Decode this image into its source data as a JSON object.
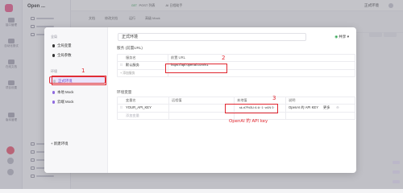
{
  "background": {
    "project_title": "Open ...",
    "rail_items": [
      "接口管理",
      "自动化测试",
      "在线文档",
      "项目设置",
      "版本管理"
    ],
    "tabs": [
      {
        "method": "GET",
        "name": "POST 列表",
        "method_color": "#2ea44f"
      },
      {
        "method": "",
        "name": "AI 日程助手",
        "method_color": "#e0733a"
      }
    ],
    "toolbar_tabs": [
      "文档",
      "修改文档",
      "运行",
      "高级 Mock"
    ],
    "top_env": "正式环境"
  },
  "modal": {
    "left": {
      "global_section": "全局",
      "global_items": [
        {
          "label": "全局变量"
        },
        {
          "label": "全局参数"
        }
      ],
      "env_section": "环境",
      "env_items": [
        {
          "label": "正式环境",
          "active": true,
          "dot": "f"
        },
        {
          "label": "本地 Mock",
          "active": false,
          "dot": "p"
        },
        {
          "label": "云端 Mock",
          "active": false,
          "dot": "p"
        }
      ],
      "add_env": "+ 新建环境"
    },
    "env_name": "正式环境",
    "share_label": "共享",
    "service_section": "服务 (前置URL)",
    "service_table": {
      "headers": [
        "服务名",
        "前置 URL"
      ],
      "rows": [
        {
          "name": "默认服务",
          "url": "https://api.openai.com/v1"
        }
      ],
      "add_label": "+ 添加服务"
    },
    "variables_section": "环境变量",
    "variables_table": {
      "headers": [
        "变量名",
        "远程值",
        "本地值",
        "说明"
      ],
      "rows": [
        {
          "name": "YOUR_API_KEY",
          "remote": "",
          "local": "sk-rt7Pd3U·A·A··1··w1N·3·",
          "desc": "OpenAI 的 API KEY",
          "more": "更多"
        }
      ],
      "add_placeholder": "添加变量"
    },
    "close_label": "关 闭",
    "save_label": "保 存"
  },
  "annotations": {
    "n1": "1",
    "n2": "2",
    "n3": "3",
    "note3": "OpenAI 的 API key",
    "color": "#e0262f"
  }
}
